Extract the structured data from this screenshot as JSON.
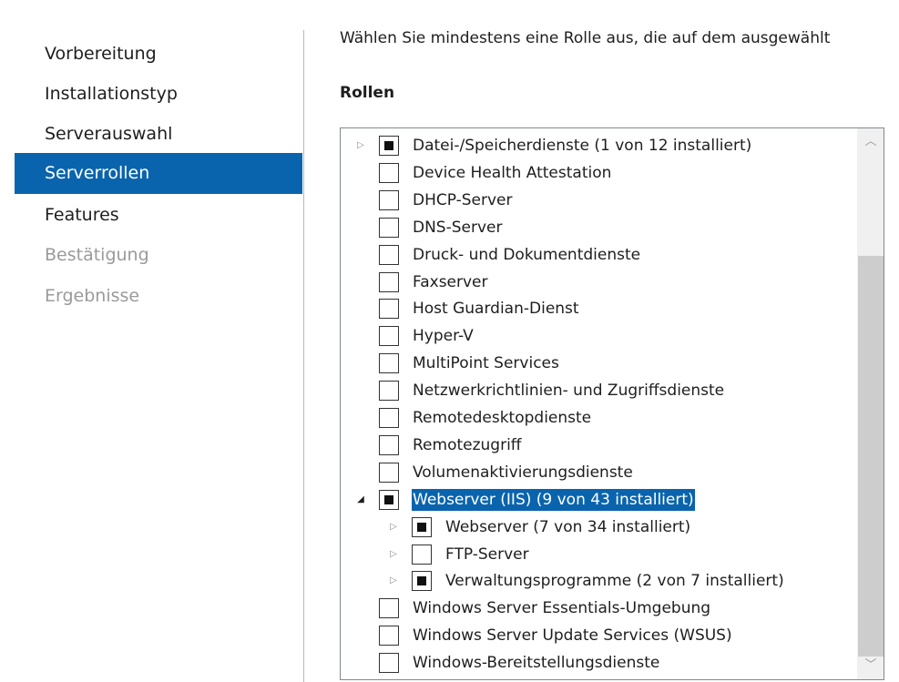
{
  "sidebar": {
    "items": [
      {
        "label": "Vorbereitung",
        "state": "normal"
      },
      {
        "label": "Installationstyp",
        "state": "normal"
      },
      {
        "label": "Serverauswahl",
        "state": "normal"
      },
      {
        "label": "Serverrollen",
        "state": "selected"
      },
      {
        "label": "Features",
        "state": "normal"
      },
      {
        "label": "Bestätigung",
        "state": "disabled"
      },
      {
        "label": "Ergebnisse",
        "state": "disabled"
      }
    ]
  },
  "main": {
    "instruction": "Wählen Sie mindestens eine Rolle aus, die auf dem ausgewählt",
    "roles_heading": "Rollen"
  },
  "roles": [
    {
      "label": "Datei-/Speicherdienste (1 von 12 installiert)",
      "level": 0,
      "expander": "collapsed",
      "checkbox": "partial",
      "selected": false
    },
    {
      "label": "Device Health Attestation",
      "level": 0,
      "expander": "none",
      "checkbox": "unchecked",
      "selected": false
    },
    {
      "label": "DHCP-Server",
      "level": 0,
      "expander": "none",
      "checkbox": "unchecked",
      "selected": false
    },
    {
      "label": "DNS-Server",
      "level": 0,
      "expander": "none",
      "checkbox": "unchecked",
      "selected": false
    },
    {
      "label": "Druck- und Dokumentdienste",
      "level": 0,
      "expander": "none",
      "checkbox": "unchecked",
      "selected": false
    },
    {
      "label": "Faxserver",
      "level": 0,
      "expander": "none",
      "checkbox": "unchecked",
      "selected": false
    },
    {
      "label": "Host Guardian-Dienst",
      "level": 0,
      "expander": "none",
      "checkbox": "unchecked",
      "selected": false
    },
    {
      "label": "Hyper-V",
      "level": 0,
      "expander": "none",
      "checkbox": "unchecked",
      "selected": false
    },
    {
      "label": "MultiPoint Services",
      "level": 0,
      "expander": "none",
      "checkbox": "unchecked",
      "selected": false
    },
    {
      "label": "Netzwerkrichtlinien- und Zugriffsdienste",
      "level": 0,
      "expander": "none",
      "checkbox": "unchecked",
      "selected": false
    },
    {
      "label": "Remotedesktopdienste",
      "level": 0,
      "expander": "none",
      "checkbox": "unchecked",
      "selected": false
    },
    {
      "label": "Remotezugriff",
      "level": 0,
      "expander": "none",
      "checkbox": "unchecked",
      "selected": false
    },
    {
      "label": "Volumenaktivierungsdienste",
      "level": 0,
      "expander": "none",
      "checkbox": "unchecked",
      "selected": false
    },
    {
      "label": "Webserver (IIS) (9 von 43 installiert)",
      "level": 0,
      "expander": "expanded",
      "checkbox": "partial",
      "selected": true
    },
    {
      "label": "Webserver (7 von 34 installiert)",
      "level": 1,
      "expander": "collapsed",
      "checkbox": "partial",
      "selected": false
    },
    {
      "label": "FTP-Server",
      "level": 1,
      "expander": "collapsed",
      "checkbox": "unchecked",
      "selected": false
    },
    {
      "label": "Verwaltungsprogramme (2 von 7 installiert)",
      "level": 1,
      "expander": "collapsed",
      "checkbox": "partial",
      "selected": false
    },
    {
      "label": "Windows Server Essentials-Umgebung",
      "level": 0,
      "expander": "none",
      "checkbox": "unchecked",
      "selected": false
    },
    {
      "label": "Windows Server Update Services (WSUS)",
      "level": 0,
      "expander": "none",
      "checkbox": "unchecked",
      "selected": false
    },
    {
      "label": "Windows-Bereitstellungsdienste",
      "level": 0,
      "expander": "none",
      "checkbox": "unchecked",
      "selected": false
    }
  ],
  "scrollbar": {
    "up_icon": "chevron-up-icon",
    "down_icon": "chevron-down-icon",
    "position_fraction": 0.3
  },
  "colors": {
    "accent": "#0a64ad",
    "disabled_text": "#9a9a9a"
  }
}
